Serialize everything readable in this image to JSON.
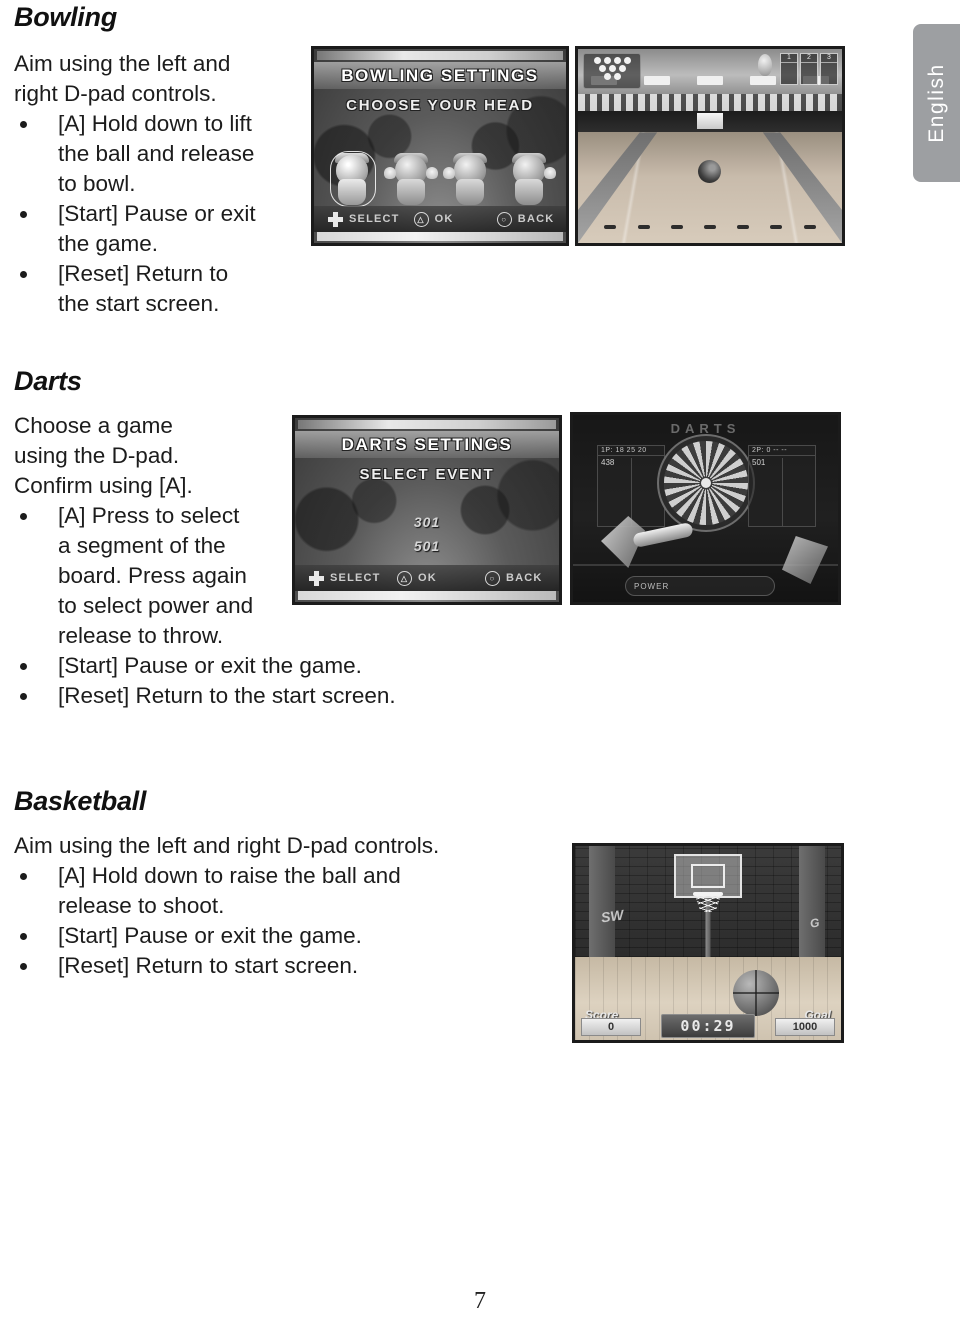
{
  "page": {
    "number": "7",
    "language_tab": "English"
  },
  "sections": [
    {
      "id": "bowling",
      "title": "Bowling",
      "intro": [
        "Aim using the left and",
        "right D-pad controls."
      ],
      "bullets": [
        [
          "[A] Hold down to lift",
          "the ball and release",
          "to bowl."
        ],
        [
          "[Start] Pause or exit",
          "the game."
        ],
        [
          "[Reset] Return to",
          "the start screen."
        ]
      ]
    },
    {
      "id": "darts",
      "title": "Darts",
      "intro": [
        "Choose a game",
        "using the D-pad.",
        "Confirm using [A]."
      ],
      "bullets": [
        [
          "[A] Press to select",
          "a segment of the",
          "board. Press again",
          "to select power and",
          "release to throw."
        ],
        [
          "[Start] Pause or exit the game."
        ],
        [
          "[Reset] Return to the start screen."
        ]
      ]
    },
    {
      "id": "basketball",
      "title": "Basketball",
      "intro": [
        "Aim using the left and right D-pad controls."
      ],
      "bullets": [
        [
          "[A] Hold down to raise the ball and",
          "release to shoot."
        ],
        [
          "[Start] Pause or exit the game."
        ],
        [
          "[Reset] Return to start screen."
        ]
      ]
    }
  ],
  "screenshots": {
    "bowling_settings": {
      "title": "BOWLING SETTINGS",
      "subtitle": "CHOOSE YOUR HEAD",
      "footer": [
        {
          "icon": "dpad-icon",
          "label": "SELECT"
        },
        {
          "icon": "triangle-button-icon",
          "glyph": "△",
          "label": "OK"
        },
        {
          "icon": "circle-button-icon",
          "glyph": "○",
          "label": "BACK"
        }
      ]
    },
    "bowling_lane": {
      "frames": [
        "1",
        "2",
        "3"
      ]
    },
    "darts_settings": {
      "title": "DARTS SETTINGS",
      "subtitle": "SELECT EVENT",
      "events": [
        "301",
        "501"
      ],
      "footer": [
        {
          "icon": "dpad-icon",
          "label": "SELECT"
        },
        {
          "icon": "triangle-button-icon",
          "glyph": "△",
          "label": "OK"
        },
        {
          "icon": "circle-button-icon",
          "glyph": "○",
          "label": "BACK"
        }
      ]
    },
    "darts_game": {
      "title": "DARTS",
      "player1_header": "1P: 18 25 20",
      "player1_score": "438",
      "player2_header": "2P: 0  --  --",
      "player2_score": "501",
      "power_label": "POWER"
    },
    "basketball_game": {
      "score_label": "Score",
      "score_value": "0",
      "timer": "00:29",
      "goal_label": "Goal",
      "goal_value": "1000",
      "graffiti_left": "SW",
      "graffiti_right": "G"
    }
  },
  "colors": {
    "tab_background": "#9d9fa2",
    "text": "#1c1c1c",
    "page_background": "#ffffff"
  }
}
